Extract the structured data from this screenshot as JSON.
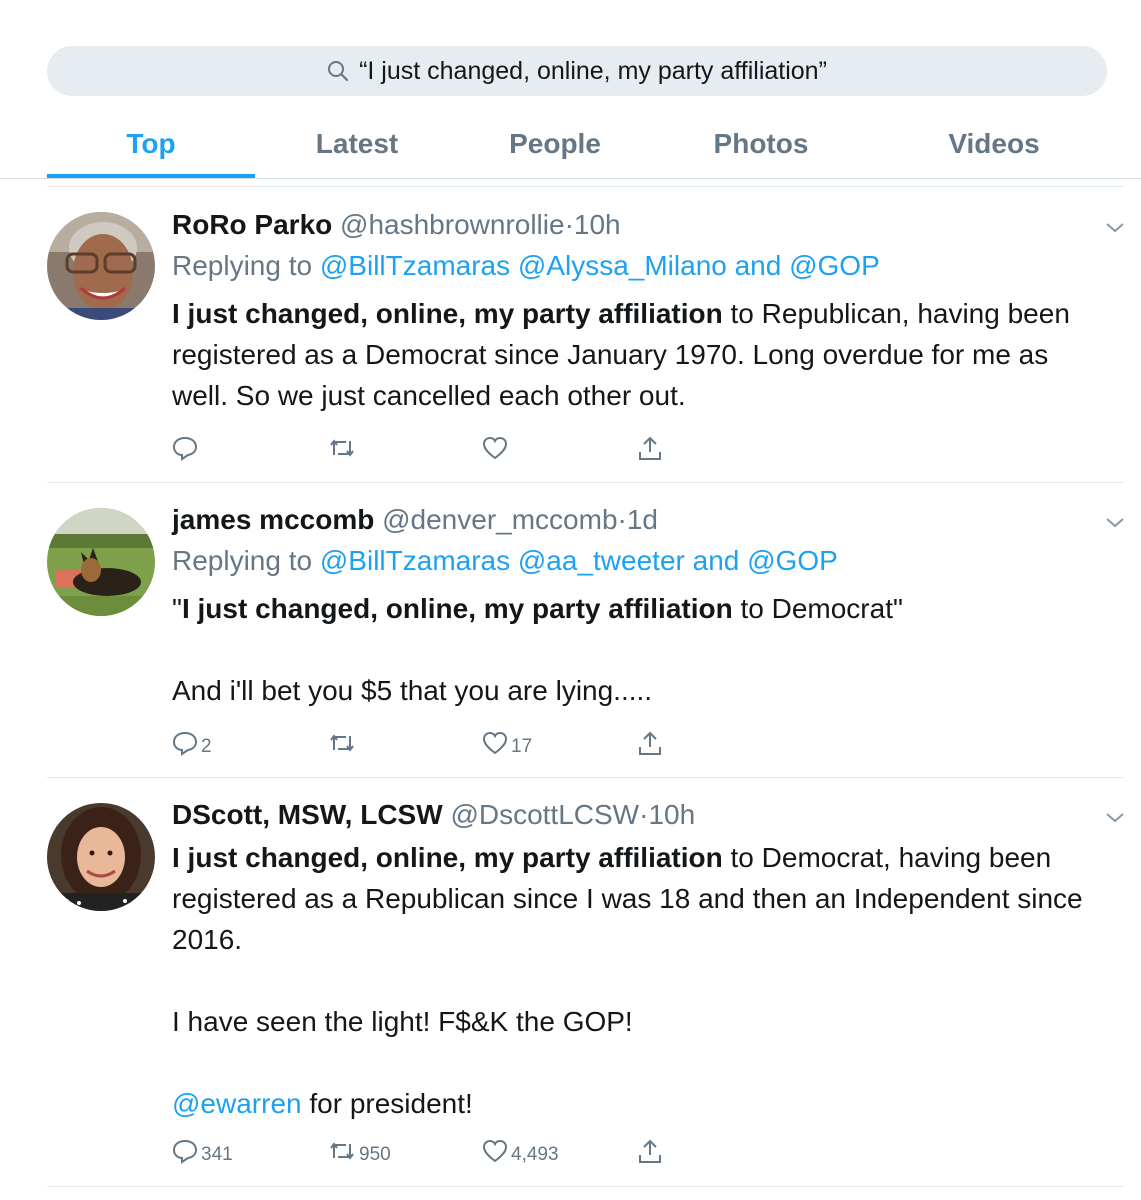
{
  "search": {
    "query": "“I just changed, online, my party affiliation”"
  },
  "tabs": [
    {
      "label": "Top",
      "active": true
    },
    {
      "label": "Latest",
      "active": false
    },
    {
      "label": "People",
      "active": false
    },
    {
      "label": "Photos",
      "active": false
    },
    {
      "label": "Videos",
      "active": false
    }
  ],
  "colors": {
    "accent": "#1da1f2",
    "muted": "#657786",
    "text": "#14171a",
    "search_bg": "#e6ecf0"
  },
  "tweets": [
    {
      "name": "RoRo Parko",
      "handle": "@hashbrownrollie",
      "dot": "·",
      "time": "10h",
      "replying_prefix": "Replying to ",
      "replying_to": "@BillTzamaras @Alyssa_Milano and @GOP",
      "body_bold": "I just changed, online, my party affiliation",
      "body_rest": " to Republican, having been registered as a Democrat since January 1970.  Long overdue for me as well.  So we just cancelled each other out.",
      "replies": "",
      "retweets": "",
      "likes": ""
    },
    {
      "name": "james mccomb",
      "handle": "@denver_mccomb",
      "dot": "·",
      "time": "1d",
      "replying_prefix": "Replying to ",
      "replying_to": "@BillTzamaras @aa_tweeter and @GOP",
      "body_quote_open": "\"",
      "body_bold": "I just changed, online, my party affiliation",
      "body_rest": " to Democrat\"",
      "body_para2": "And i'll bet you $5 that you are lying.....",
      "replies": "2",
      "retweets": "",
      "likes": "17"
    },
    {
      "name": "DScott, MSW, LCSW",
      "handle": "@DscottLCSW",
      "dot": "·",
      "time": "10h",
      "body_bold": "I just changed, online, my party affiliation",
      "body_rest": " to Democrat, having been registered as a Republican since I was 18 and then an Independent since 2016.",
      "body_para2": "I have seen the light!  F$&K the GOP!",
      "body_mention": "@ewarren",
      "body_para3_rest": " for president!",
      "replies": "341",
      "retweets": "950",
      "likes": "4,493"
    }
  ]
}
